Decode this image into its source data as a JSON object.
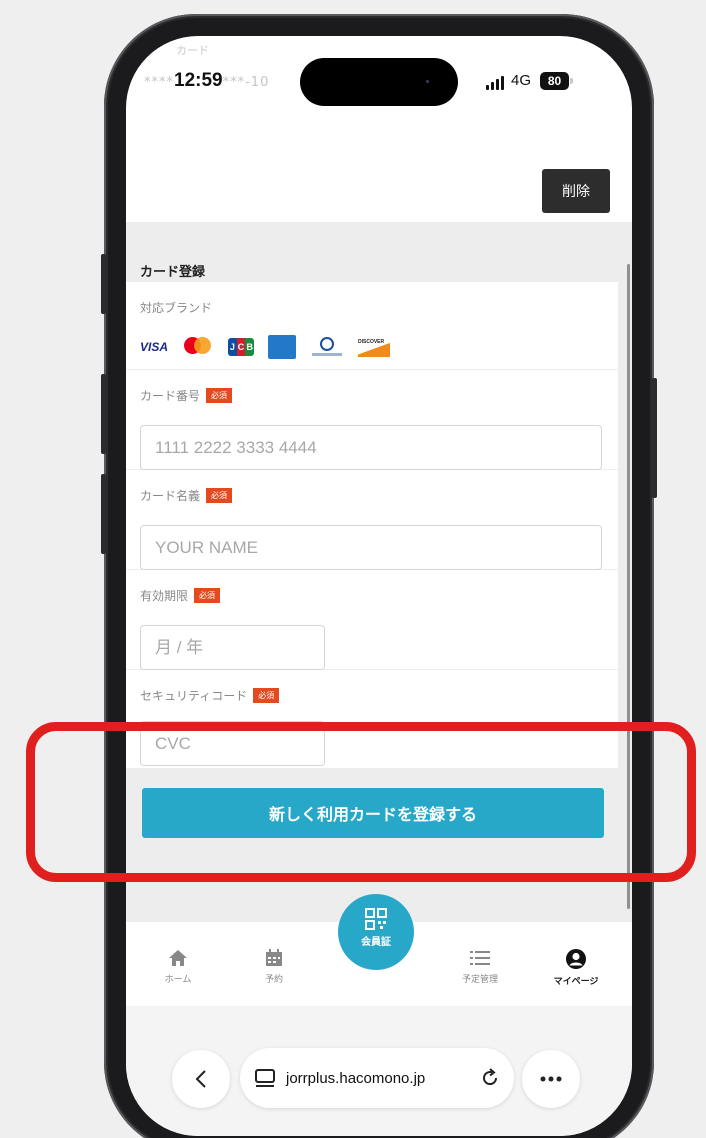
{
  "status_bar": {
    "faded_title": "カード",
    "time_prefix": "****",
    "time": "12:59",
    "time_suffix": "***-10",
    "network": "4G",
    "battery": "80"
  },
  "header": {
    "delete_label": "削除"
  },
  "form": {
    "section_title": "カード登録",
    "brands_label": "対応ブランド",
    "brands": [
      "visa",
      "mastercard",
      "jcb",
      "american-express",
      "diners-club",
      "discover"
    ],
    "brand_text": {
      "visa": "VISA",
      "jcb": "JCB",
      "discover": "DISCOVER"
    },
    "required_badge": "必須",
    "card_number": {
      "label": "カード番号",
      "placeholder": "1111 2222 3333 4444"
    },
    "card_name": {
      "label": "カード名義",
      "placeholder": "YOUR NAME"
    },
    "expiry": {
      "label": "有効期限",
      "placeholder": "月 / 年"
    },
    "security_code": {
      "label": "セキュリティコード",
      "placeholder": "CVC"
    },
    "submit_label": "新しく利用カードを登録する"
  },
  "tabbar": {
    "items": [
      {
        "label": "ホーム",
        "icon": "home-icon"
      },
      {
        "label": "予約",
        "icon": "calendar-icon"
      },
      {
        "label": "会員証",
        "icon": "qr-code-icon"
      },
      {
        "label": "予定管理",
        "icon": "list-icon"
      },
      {
        "label": "マイページ",
        "icon": "user-icon"
      }
    ],
    "active": "マイページ"
  },
  "browser": {
    "url": "jorrplus.hacomono.jp"
  },
  "colors": {
    "accent": "#27a8c8",
    "required": "#e34a1f",
    "highlight": "#e01f1f",
    "dark_button": "#2d2d2d"
  }
}
